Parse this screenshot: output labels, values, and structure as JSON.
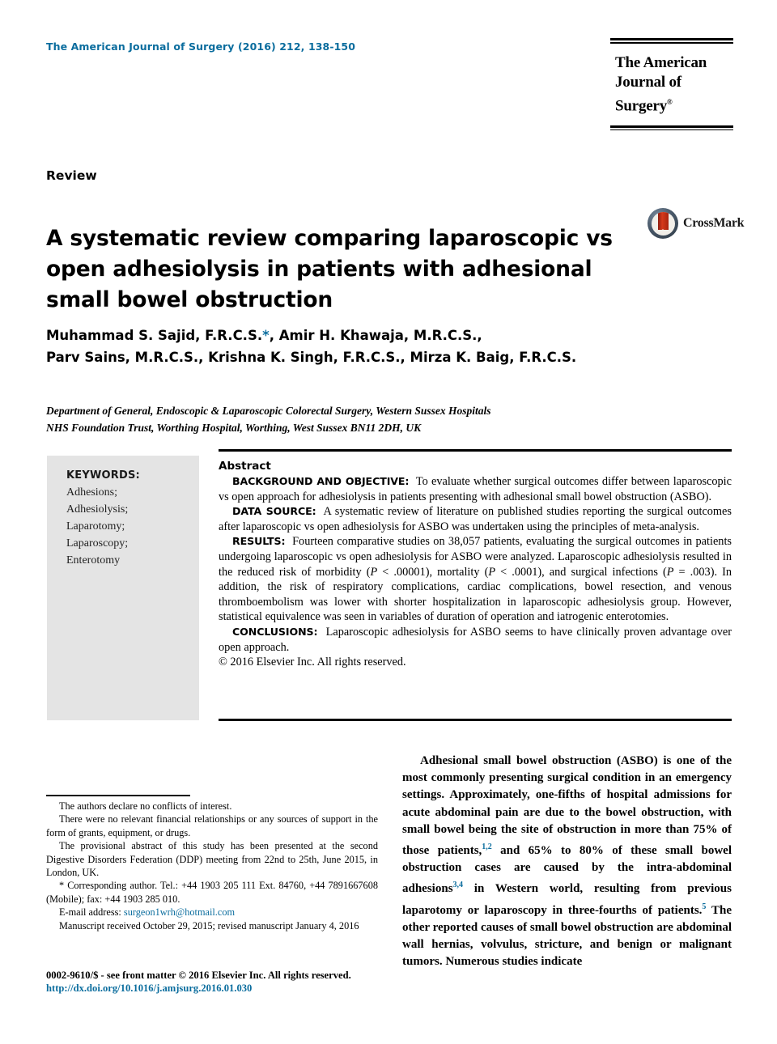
{
  "header": {
    "journal_reference": "The American Journal of Surgery (2016) 212, 138-150",
    "masthead_line1": "The American",
    "masthead_line2": "Journal of Surgery",
    "masthead_registered": "®"
  },
  "article": {
    "type": "Review",
    "title": "A systematic review comparing laparoscopic vs open adhesiolysis in patients with adhesional small bowel obstruction",
    "crossmark_label": "CrossMark",
    "authors_line1_pre": "Muhammad S. Sajid, F.R.C.S.",
    "authors_star": "*",
    "authors_line1_post": ", Amir H. Khawaja, M.R.C.S.,",
    "authors_line2": "Parv Sains, M.R.C.S., Krishna K. Singh, F.R.C.S., Mirza K. Baig, F.R.C.S.",
    "affiliation_line1": "Department of General, Endoscopic & Laparoscopic Colorectal Surgery, Western Sussex Hospitals",
    "affiliation_line2": "NHS Foundation Trust, Worthing Hospital, Worthing, West Sussex BN11 2DH, UK"
  },
  "keywords": {
    "title": "KEYWORDS:",
    "items": [
      "Adhesions;",
      "Adhesiolysis;",
      "Laparotomy;",
      "Laparoscopy;",
      "Enterotomy"
    ]
  },
  "abstract": {
    "heading": "Abstract",
    "sections": [
      {
        "label": "BACKGROUND AND OBJECTIVE:",
        "text": "To evaluate whether surgical outcomes differ between laparoscopic vs open approach for adhesiolysis in patients presenting with adhesional small bowel obstruction (ASBO)."
      },
      {
        "label": "DATA SOURCE:",
        "text": "A systematic review of literature on published studies reporting the surgical outcomes after laparoscopic vs open adhesiolysis for ASBO was undertaken using the principles of meta-analysis."
      },
      {
        "label": "RESULTS:",
        "text_part1": "Fourteen comparative studies on 38,057 patients, evaluating the surgical outcomes in patients undergoing laparoscopic vs open adhesiolysis for ASBO were analyzed. Laparoscopic adhesiolysis resulted in the reduced risk of morbidity (",
        "stat1_italic": "P",
        "stat1_rest": " < .00001), mortality (",
        "stat2_italic": "P",
        "stat2_rest": " < .0001), and surgical infections (",
        "stat3_italic": "P",
        "stat3_rest": " = .003). In addition, the risk of respiratory complications, cardiac complications, bowel resection, and venous thromboembolism was lower with shorter hospitalization in laparoscopic adhesiolysis group. However, statistical equivalence was seen in variables of duration of operation and iatrogenic enterotomies."
      },
      {
        "label": "CONCLUSIONS:",
        "text": "Laparoscopic adhesiolysis for ASBO seems to have clinically proven advantage over open approach."
      }
    ],
    "copyright": "© 2016 Elsevier Inc. All rights reserved."
  },
  "footnotes": {
    "p1": "The authors declare no conflicts of interest.",
    "p2": "There were no relevant financial relationships or any sources of support in the form of grants, equipment, or drugs.",
    "p3": "The provisional abstract of this study has been presented at the second Digestive Disorders Federation (DDP) meeting from 22nd to 25th, June 2015, in London, UK.",
    "p4": "* Corresponding author. Tel.: +44 1903 205 111 Ext. 84760, +44 7891667608 (Mobile); fax: +44 1903 285 010.",
    "email_label": "E-mail address:",
    "email": "surgeon1wrh@hotmail.com",
    "p5": "Manuscript received October 29, 2015; revised manuscript January 4, 2016"
  },
  "body": {
    "paragraph1_part1": "Adhesional small bowel obstruction (ASBO) is one of the most commonly presenting surgical condition in an emergency settings. Approximately, one-fifths of hospital admissions for acute abdominal pain are due to the bowel obstruction, with small bowel being the site of obstruction in more than 75% of those patients,",
    "ref1": "1,2",
    "paragraph1_part2": " and 65% to 80% of these small bowel obstruction cases are caused by the intra-abdominal adhesions",
    "ref2": "3,4",
    "paragraph1_part3": " in Western world, resulting from previous laparotomy or laparoscopy in three-fourths of patients.",
    "ref3": "5",
    "paragraph1_part4": " The other reported causes of small bowel obstruction are abdominal wall hernias, volvulus, stricture, and benign or malignant tumors. Numerous studies indicate"
  },
  "footer": {
    "issn_line": "0002-9610/$ - see front matter © 2016 Elsevier Inc. All rights reserved.",
    "doi_line": "http://dx.doi.org/10.1016/j.amjsurg.2016.01.030"
  },
  "colors": {
    "link_blue": "#0b6d9e",
    "keywords_bg": "#e4e4e4",
    "crossmark_red": "#a8240f"
  }
}
